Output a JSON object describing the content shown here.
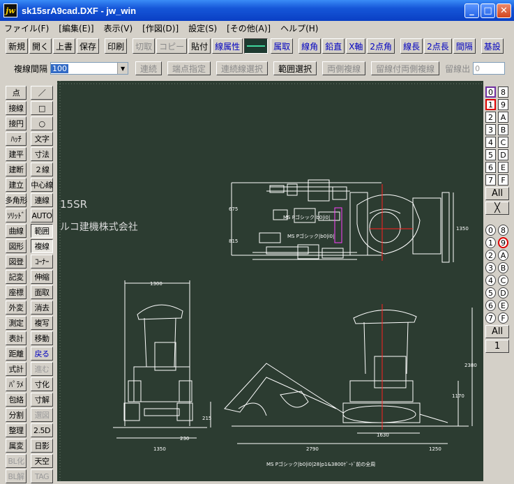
{
  "window": {
    "title": "sk15srA9cad.DXF - jw_win",
    "app_icon": "jw"
  },
  "menu": [
    "ファイル(F)",
    "[編集(E)]",
    "表示(V)",
    "[作図(D)]",
    "設定(S)",
    "[その他(A)]",
    "ヘルプ(H)"
  ],
  "toolbar1": [
    {
      "label": "新規",
      "state": "normal"
    },
    {
      "label": "開く",
      "state": "normal"
    },
    {
      "label": "上書",
      "state": "normal"
    },
    {
      "label": "保存",
      "state": "normal"
    },
    {
      "label": "印刷",
      "state": "normal"
    },
    {
      "label": "切取",
      "state": "disabled"
    },
    {
      "label": "コピー",
      "state": "disabled"
    },
    {
      "label": "貼付",
      "state": "normal"
    },
    {
      "label": "線属性",
      "state": "blue"
    },
    {
      "label": "属取",
      "state": "blue"
    },
    {
      "label": "線角",
      "state": "blue"
    },
    {
      "label": "鉛直",
      "state": "blue"
    },
    {
      "label": "X軸",
      "state": "blue"
    },
    {
      "label": "2点角",
      "state": "blue"
    },
    {
      "label": "線長",
      "state": "blue"
    },
    {
      "label": "2点長",
      "state": "blue"
    },
    {
      "label": "間隔",
      "state": "blue"
    },
    {
      "label": "基設",
      "state": "blue"
    }
  ],
  "toolbar2": {
    "label": "複線間隔",
    "value": "100",
    "buttons": [
      {
        "label": "連続",
        "state": "disabled"
      },
      {
        "label": "端点指定",
        "state": "disabled"
      },
      {
        "label": "連続線選択",
        "state": "disabled"
      },
      {
        "label": "範囲選択",
        "state": "normal"
      },
      {
        "label": "両側複線",
        "state": "disabled"
      },
      {
        "label": "留線付両側複線",
        "state": "disabled"
      }
    ],
    "out_label": "留線出",
    "out_value": "0"
  },
  "left_tools": [
    [
      "点",
      "／"
    ],
    [
      "接線",
      "□"
    ],
    [
      "接円",
      "○"
    ],
    [
      "ﾊｯﾁ",
      "文字"
    ],
    [
      "建平",
      "寸法"
    ],
    [
      "建断",
      "２線"
    ],
    [
      "建立",
      "中心線"
    ],
    [
      "多角形",
      "連線"
    ],
    [
      "ｿﾘｯﾄﾞ",
      "AUTO"
    ],
    [
      "曲線",
      "範囲"
    ],
    [
      "図形",
      "複線"
    ],
    [
      "図登",
      "ｺｰﾅｰ"
    ],
    [
      "記変",
      "伸縮"
    ],
    [
      "座標",
      "面取"
    ],
    [
      "外変",
      "消去"
    ],
    [
      "測定",
      "複写"
    ],
    [
      "表計",
      "移動"
    ],
    [
      "距離",
      "戻る"
    ],
    [
      "式計",
      "進む"
    ],
    [
      "ﾊﾟﾗﾒ",
      "寸化"
    ],
    [
      "包絡",
      "寸解"
    ],
    [
      "分割",
      "選図"
    ],
    [
      "整理",
      "2.5D"
    ],
    [
      "属変",
      "日影"
    ],
    [
      "BL化",
      "天空"
    ],
    [
      "BL解",
      "TAG"
    ]
  ],
  "drawing": {
    "model": "15SR",
    "company": "ルコ建機株式会社",
    "dims": {
      "d1300": "1300",
      "d1350a": "1350",
      "d230": "230",
      "d215": "215",
      "d2790": "2790",
      "d1630": "1630",
      "d1250": "1250",
      "d2380": "2380",
      "d1170": "1170",
      "d1350b": "1350",
      "d675": "675",
      "d815": "815"
    },
    "note1": "MS Pゴシック|b0|i0|",
    "note2": "MS Pゴシック|b0|i0|",
    "footer": "MS Pゴシック|b0|i0|28|p1&3800ｹﾞｰﾄﾞ前の全周"
  },
  "layers_top": [
    [
      "0",
      "8"
    ],
    [
      "1",
      "9"
    ],
    [
      "2",
      "A"
    ],
    [
      "3",
      "B"
    ],
    [
      "4",
      "C"
    ],
    [
      "5",
      "D"
    ],
    [
      "6",
      "E"
    ],
    [
      "7",
      "F"
    ]
  ],
  "layers_bottom": [
    [
      "0",
      "8"
    ],
    [
      "1",
      "9"
    ],
    [
      "2",
      "A"
    ],
    [
      "3",
      "B"
    ],
    [
      "4",
      "C"
    ],
    [
      "5",
      "D"
    ],
    [
      "6",
      "E"
    ],
    [
      "7",
      "F"
    ]
  ],
  "all_label": "All",
  "x_label": "╳",
  "one_label": "1",
  "colors": {
    "canvas": "#2c3c31",
    "line": "#ffffff",
    "accent_red": "#ff2020",
    "highlight": "#ff40ff"
  }
}
